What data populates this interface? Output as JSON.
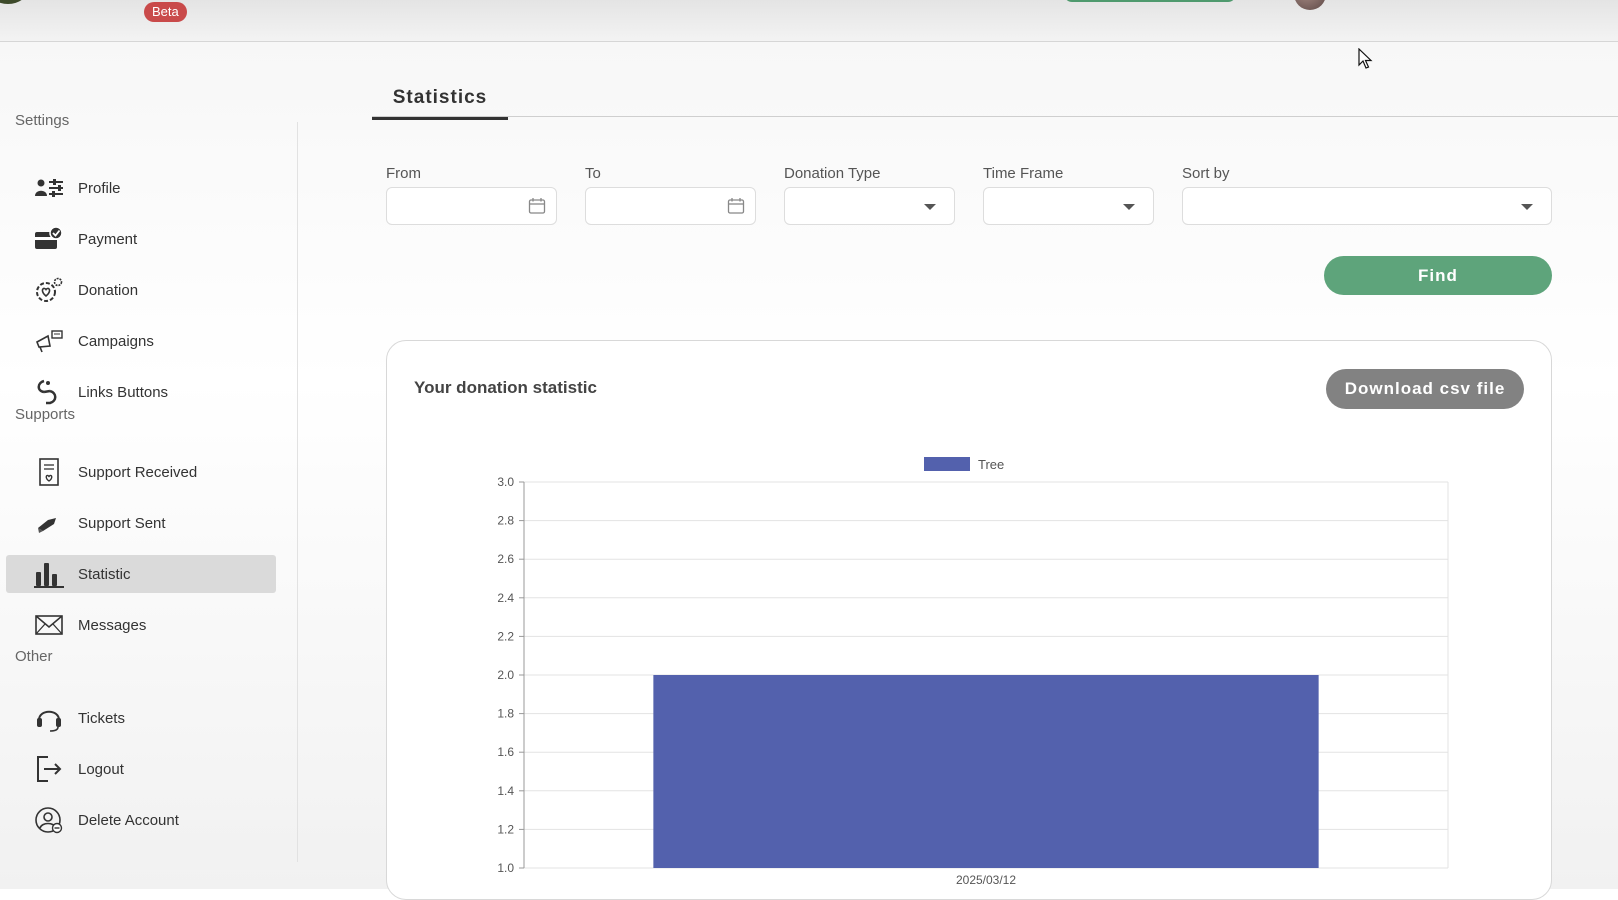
{
  "header": {
    "beta_label": "Beta"
  },
  "sidebar": {
    "sections": [
      {
        "title": "Settings",
        "items": [
          {
            "label": "Profile",
            "icon": "profile-sliders-icon"
          },
          {
            "label": "Payment",
            "icon": "wallet-check-icon"
          },
          {
            "label": "Donation",
            "icon": "heart-gear-icon"
          },
          {
            "label": "Campaigns",
            "icon": "megaphone-icon"
          },
          {
            "label": "Links Buttons",
            "icon": "link-icon"
          }
        ]
      },
      {
        "title": "Supports",
        "items": [
          {
            "label": "Support Received",
            "icon": "document-heart-icon"
          },
          {
            "label": "Support Sent",
            "icon": "send-icon"
          },
          {
            "label": "Statistic",
            "icon": "bar-chart-icon",
            "active": true
          },
          {
            "label": "Messages",
            "icon": "envelope-icon"
          }
        ]
      },
      {
        "title": "Other",
        "items": [
          {
            "label": "Tickets",
            "icon": "headset-icon"
          },
          {
            "label": "Logout",
            "icon": "logout-icon"
          },
          {
            "label": "Delete Account",
            "icon": "user-remove-icon"
          }
        ]
      }
    ]
  },
  "main": {
    "tab": "Statistics",
    "filters": {
      "from_label": "From",
      "from_value": "",
      "to_label": "To",
      "to_value": "",
      "donation_type_label": "Donation Type",
      "donation_type_value": "",
      "time_frame_label": "Time Frame",
      "time_frame_value": "",
      "sort_by_label": "Sort by",
      "sort_by_value": ""
    },
    "find_label": "Find",
    "card": {
      "title": "Your donation statistic",
      "download_label": "Download csv file"
    }
  },
  "colors": {
    "accent_green": "#5ea47b",
    "bar_fill": "#5361ad",
    "csv_button": "#828282",
    "badge": "#c94a4a"
  },
  "chart_data": {
    "type": "bar",
    "categories": [
      "2025/03/12"
    ],
    "series": [
      {
        "name": "Tree",
        "values": [
          2.0
        ]
      }
    ],
    "ylim": [
      1.0,
      3.0
    ],
    "yticks": [
      "1.0",
      "1.2",
      "1.4",
      "1.6",
      "1.8",
      "2.0",
      "2.2",
      "2.4",
      "2.6",
      "2.8",
      "3.0"
    ],
    "grid": true,
    "legend": "top-center"
  }
}
